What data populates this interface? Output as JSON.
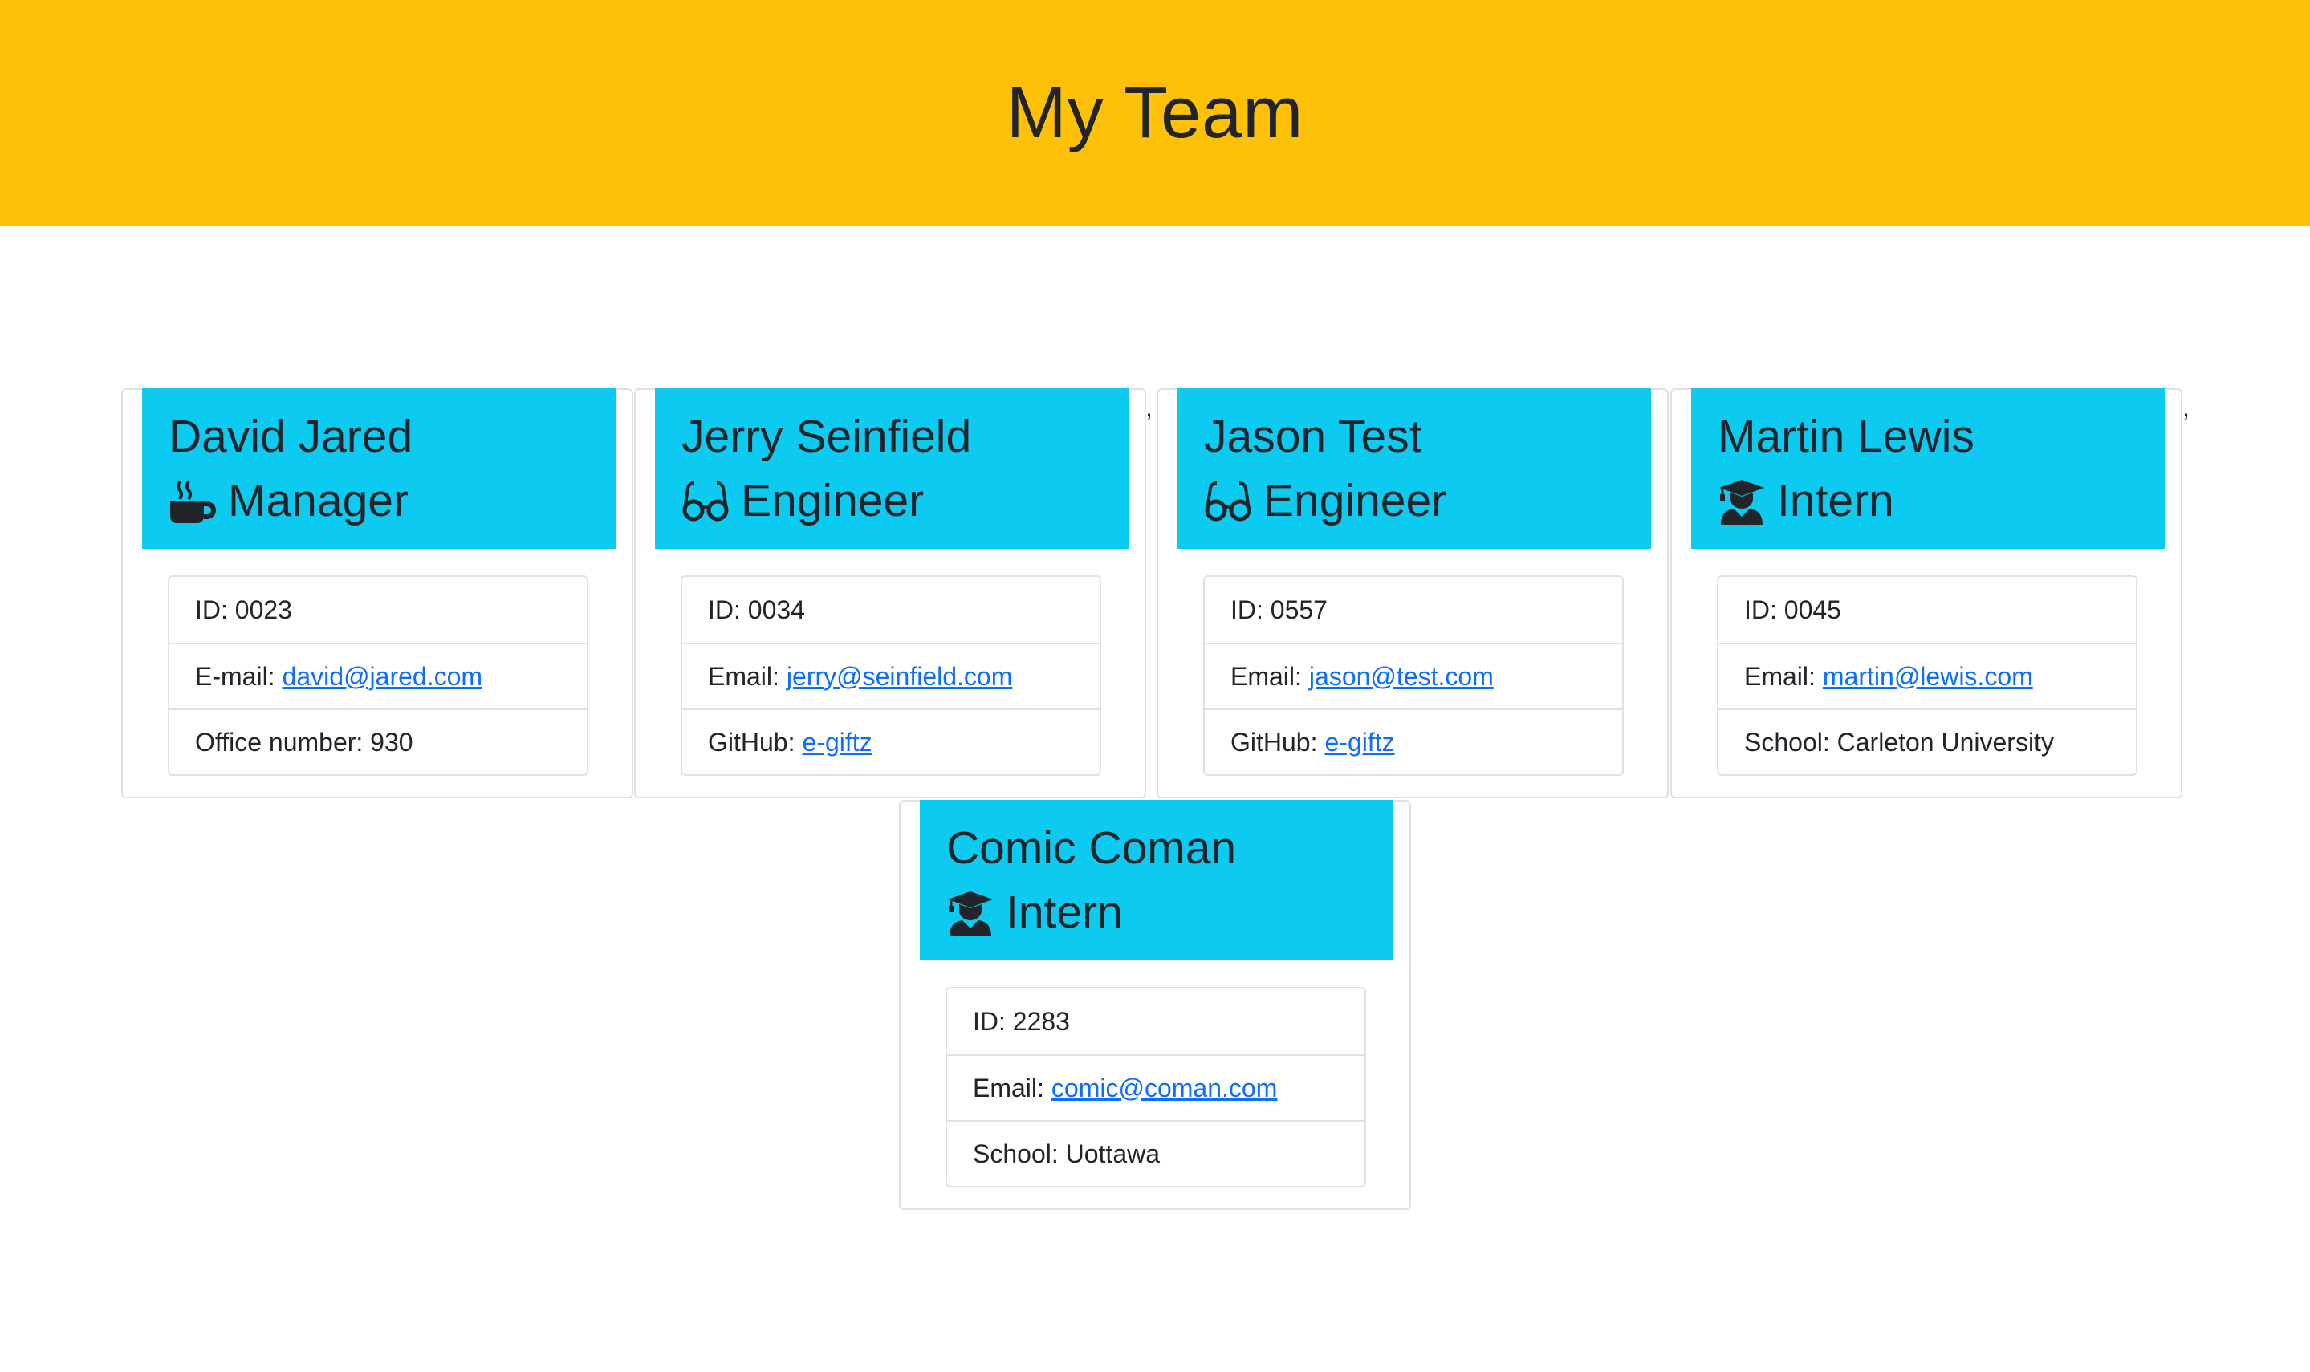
{
  "header": {
    "title": "My Team"
  },
  "team": [
    {
      "name": "David Jared",
      "role": "Manager",
      "icon": "coffee-mug-icon",
      "id_label": "ID: 0023",
      "email_label": "E-mail:",
      "email": "david@jared.com",
      "extra_label": "Office number: 930",
      "extra_link": ""
    },
    {
      "name": "Jerry Seinfield",
      "role": "Engineer",
      "icon": "glasses-icon",
      "id_label": "ID: 0034",
      "email_label": "Email:",
      "email": "jerry@seinfield.com",
      "extra_label": "GitHub:",
      "extra_link": "e-giftz"
    },
    {
      "name": "Jason Test",
      "role": "Engineer",
      "icon": "glasses-icon",
      "id_label": "ID: 0557",
      "email_label": "Email:",
      "email": "jason@test.com",
      "extra_label": "GitHub:",
      "extra_link": "e-giftz"
    },
    {
      "name": "Martin Lewis",
      "role": "Intern",
      "icon": "graduate-icon",
      "id_label": "ID: 0045",
      "email_label": "Email:",
      "email": "martin@lewis.com",
      "extra_label": "School: Carleton University",
      "extra_link": ""
    },
    {
      "name": "Comic Coman",
      "role": "Intern",
      "icon": "graduate-icon",
      "id_label": "ID: 2283",
      "email_label": "Email:",
      "email": "comic@coman.com",
      "extra_label": "School: Uottawa",
      "extra_link": ""
    }
  ],
  "stray_commas": [
    ",",
    ","
  ],
  "colors": {
    "header_bg": "#ffc107",
    "card_header_bg": "#0dcaf0",
    "link": "#0d6efd"
  }
}
